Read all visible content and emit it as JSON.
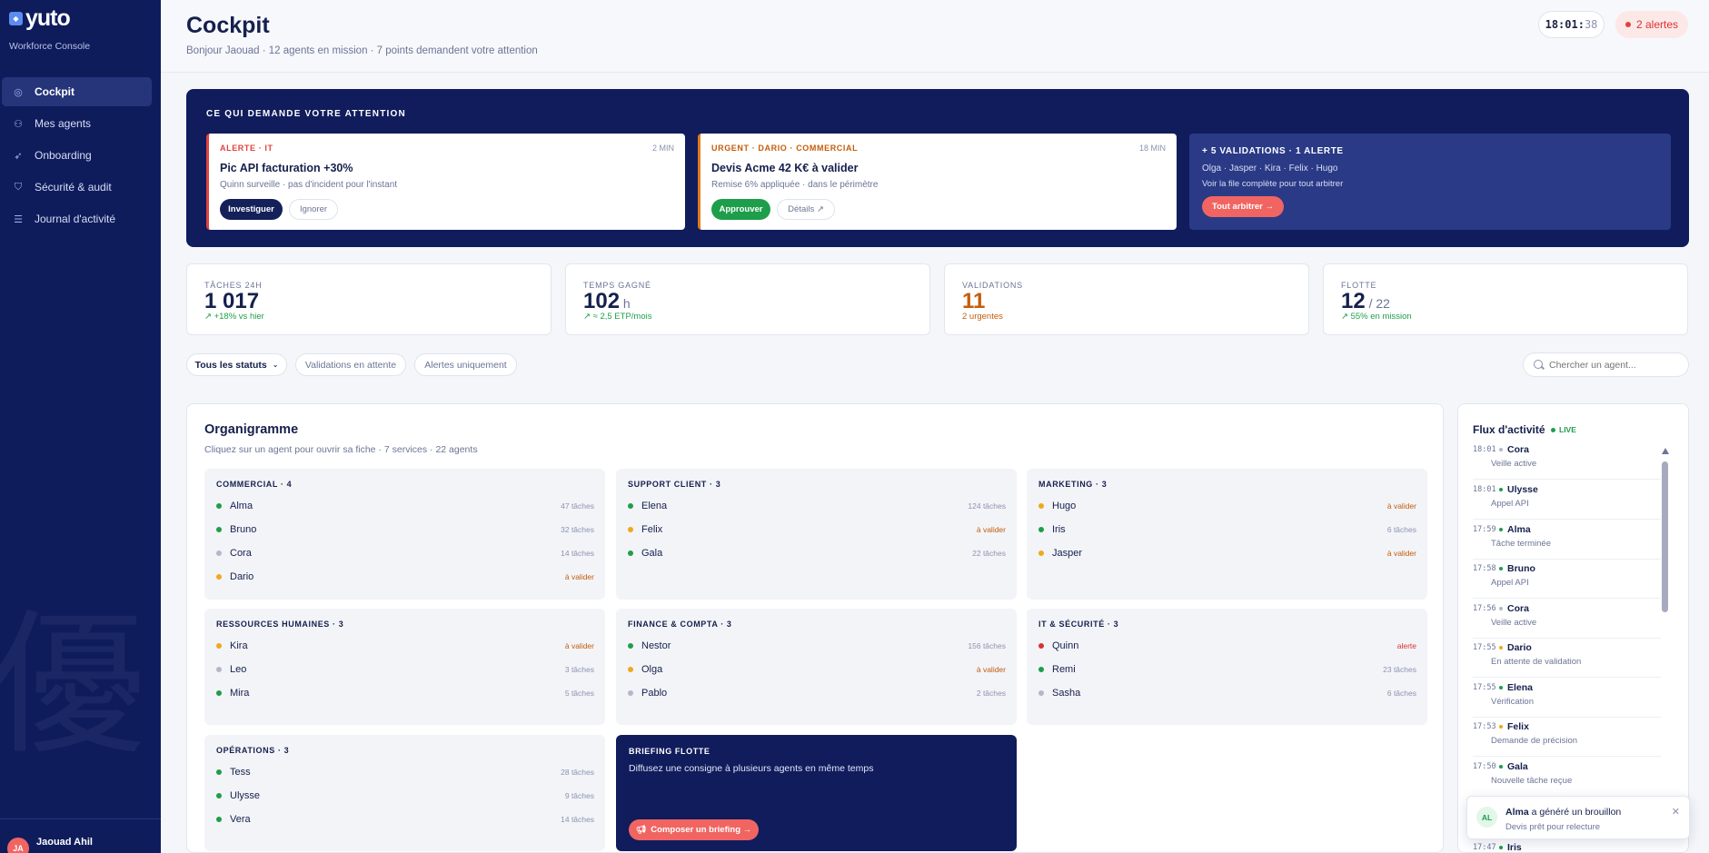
{
  "brand": {
    "logo_text": "yuto",
    "logo_tagline": "Workforce Console"
  },
  "sidebar": {
    "items": [
      {
        "label": "Cockpit",
        "icon": "gauge-icon"
      },
      {
        "label": "Mes agents",
        "icon": "users-icon"
      },
      {
        "label": "Onboarding",
        "icon": "rocket-icon"
      },
      {
        "label": "Sécurité & audit",
        "icon": "shield-icon"
      },
      {
        "label": "Journal d'activité",
        "icon": "journal-icon"
      }
    ],
    "user": {
      "initials": "JA",
      "name": "Jaouad Ahil"
    }
  },
  "header": {
    "title": "Cockpit",
    "subtitle": "Bonjour Jaouad · 12 agents en mission · 7 points demandent votre attention",
    "clock_hm": "18:01:",
    "clock_s": "38",
    "alerts": "2 alertes"
  },
  "attention": {
    "title": "CE QUI DEMANDE VOTRE ATTENTION",
    "cards": [
      {
        "tag": "ALERTE · IT",
        "time": "2 MIN",
        "title": "Pic API facturation +30%",
        "desc": "Quinn surveille · pas d'incident pour l'instant",
        "primary": "Investiguer",
        "secondary": "Ignorer"
      },
      {
        "tag": "URGENT · DARIO · COMMERCIAL",
        "time": "18 MIN",
        "title": "Devis Acme 42 K€ à valider",
        "desc": "Remise 6% appliquée · dans le périmètre",
        "primary": "Approuver",
        "secondary": "Détails ↗"
      }
    ],
    "more": {
      "title": "+ 5 VALIDATIONS · 1 ALERTE",
      "names": "Olga · Jasper · Kira · Felix · Hugo",
      "desc": "Voir la file complète pour tout arbitrer",
      "button": "Tout arbitrer →"
    }
  },
  "kpis": [
    {
      "label": "TÂCHES 24H",
      "value": "1 017",
      "unit": "",
      "trend": "↗ +18% vs hier"
    },
    {
      "label": "TEMPS GAGNÉ",
      "value": "102",
      "unit": " h",
      "trend": "↗ ≈ 2,5 ETP/mois"
    },
    {
      "label": "VALIDATIONS",
      "value": "11",
      "unit": "",
      "trend": "2 urgentes"
    },
    {
      "label": "FLOTTE",
      "value": "12",
      "unit": " / 22",
      "trend": "↗ 55% en mission"
    }
  ],
  "filters": {
    "chips": [
      "Tous les statuts",
      "Validations en attente",
      "Alertes uniquement"
    ],
    "search_placeholder": "Chercher un agent..."
  },
  "org": {
    "title": "Organigramme",
    "subtitle": "Cliquez sur un agent pour ouvrir sa fiche · 7 services · 22 agents",
    "departments": [
      {
        "name": "COMMERCIAL · 4",
        "agents": [
          {
            "name": "Alma",
            "status": "green",
            "meta": "47 tâches",
            "kind": "tasks"
          },
          {
            "name": "Bruno",
            "status": "green",
            "meta": "32 tâches",
            "kind": "tasks"
          },
          {
            "name": "Cora",
            "status": "gray",
            "meta": "14 tâches",
            "kind": "tasks"
          },
          {
            "name": "Dario",
            "status": "yellow",
            "meta": "à valider",
            "kind": "pending"
          }
        ]
      },
      {
        "name": "SUPPORT CLIENT · 3",
        "agents": [
          {
            "name": "Elena",
            "status": "green",
            "meta": "124 tâches",
            "kind": "tasks"
          },
          {
            "name": "Felix",
            "status": "yellow",
            "meta": "à valider",
            "kind": "pending"
          },
          {
            "name": "Gala",
            "status": "green",
            "meta": "22 tâches",
            "kind": "tasks"
          }
        ]
      },
      {
        "name": "MARKETING · 3",
        "agents": [
          {
            "name": "Hugo",
            "status": "yellow",
            "meta": "à valider",
            "kind": "pending"
          },
          {
            "name": "Iris",
            "status": "green",
            "meta": "6 tâches",
            "kind": "tasks"
          },
          {
            "name": "Jasper",
            "status": "yellow",
            "meta": "à valider",
            "kind": "pending"
          }
        ]
      },
      {
        "name": "RESSOURCES HUMAINES · 3",
        "agents": [
          {
            "name": "Kira",
            "status": "yellow",
            "meta": "à valider",
            "kind": "pending"
          },
          {
            "name": "Leo",
            "status": "gray",
            "meta": "3 tâches",
            "kind": "tasks"
          },
          {
            "name": "Mira",
            "status": "green",
            "meta": "5 tâches",
            "kind": "tasks"
          }
        ]
      },
      {
        "name": "FINANCE & COMPTA · 3",
        "agents": [
          {
            "name": "Nestor",
            "status": "green",
            "meta": "156 tâches",
            "kind": "tasks"
          },
          {
            "name": "Olga",
            "status": "yellow",
            "meta": "à valider",
            "kind": "pending"
          },
          {
            "name": "Pablo",
            "status": "gray",
            "meta": "2 tâches",
            "kind": "tasks"
          }
        ]
      },
      {
        "name": "IT & SÉCURITÉ · 3",
        "agents": [
          {
            "name": "Quinn",
            "status": "red",
            "meta": "alerte",
            "kind": "alert"
          },
          {
            "name": "Remi",
            "status": "green",
            "meta": "23 tâches",
            "kind": "tasks"
          },
          {
            "name": "Sasha",
            "status": "gray",
            "meta": "6 tâches",
            "kind": "tasks"
          }
        ]
      },
      {
        "name": "OPÉRATIONS · 3",
        "agents": [
          {
            "name": "Tess",
            "status": "green",
            "meta": "28 tâches",
            "kind": "tasks"
          },
          {
            "name": "Ulysse",
            "status": "green",
            "meta": "9 tâches",
            "kind": "tasks"
          },
          {
            "name": "Vera",
            "status": "green",
            "meta": "14 tâches",
            "kind": "tasks"
          }
        ]
      }
    ],
    "briefing": {
      "title": "BRIEFING FLOTTE",
      "desc": "Diffusez une consigne à plusieurs agents en même temps",
      "button": "Composer un briefing →"
    }
  },
  "feed": {
    "title": "Flux d'activité",
    "live": "LIVE",
    "items": [
      {
        "time": "18:01",
        "name": "Cora",
        "desc": "Veille active",
        "status": "gray"
      },
      {
        "time": "18:01",
        "name": "Ulysse",
        "desc": "Appel API",
        "status": "green"
      },
      {
        "time": "17:59",
        "name": "Alma",
        "desc": "Tâche terminée",
        "status": "green"
      },
      {
        "time": "17:58",
        "name": "Bruno",
        "desc": "Appel API",
        "status": "green"
      },
      {
        "time": "17:56",
        "name": "Cora",
        "desc": "Veille active",
        "status": "gray"
      },
      {
        "time": "17:55",
        "name": "Dario",
        "desc": "En attente de validation",
        "status": "yellow"
      },
      {
        "time": "17:55",
        "name": "Elena",
        "desc": "Vérification",
        "status": "green"
      },
      {
        "time": "17:53",
        "name": "Felix",
        "desc": "Demande de précision",
        "status": "yellow"
      },
      {
        "time": "17:50",
        "name": "Gala",
        "desc": "Nouvelle tâche reçue",
        "status": "green"
      },
      {
        "time": "17:47",
        "name": "Iris",
        "desc": "",
        "status": "green"
      }
    ]
  },
  "toast": {
    "initials": "AL",
    "name": "Alma",
    "action": " a généré un brouillon",
    "desc": "Devis prêt pour relecture"
  },
  "colors": {
    "green": "#1e9e4a",
    "yellow": "#f0a81c",
    "gray": "#b3b8c8",
    "red": "#d93232"
  }
}
